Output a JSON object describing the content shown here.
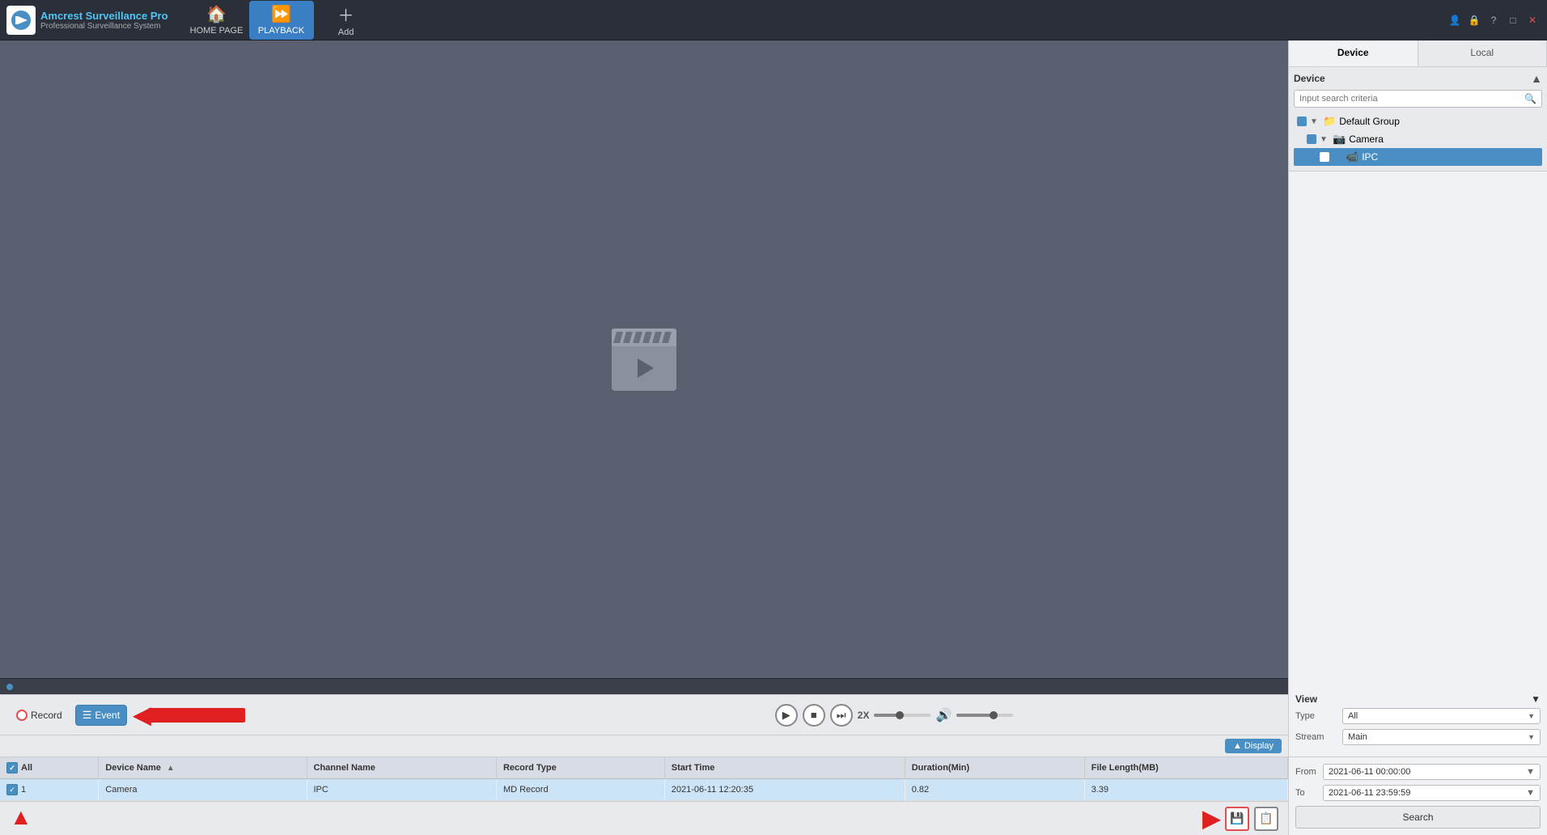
{
  "app": {
    "name": "Amcrest Surveillance Pro",
    "subtitle": "Professional Surveillance System"
  },
  "titlebar": {
    "nav": [
      {
        "id": "home",
        "label": "HOME PAGE",
        "icon": "🏠",
        "active": false
      },
      {
        "id": "playback",
        "label": "PLAYBACK",
        "icon": "▶",
        "active": true
      },
      {
        "id": "add",
        "label": "Add",
        "icon": "+",
        "active": false
      }
    ],
    "controls": [
      "👤",
      "🔒",
      "?",
      "□",
      "×"
    ]
  },
  "controls": {
    "record_label": "Record",
    "event_label": "Event",
    "speed": "2X",
    "display_label": "▲ Display"
  },
  "table": {
    "columns": [
      "All",
      "Device Name",
      "Channel Name",
      "Record Type",
      "Start Time",
      "Duration(Min)",
      "File Length(MB)"
    ],
    "rows": [
      {
        "num": "1",
        "device_name": "Camera",
        "channel_name": "IPC",
        "record_type": "MD Record",
        "start_time": "2021-06-11 12:20:35",
        "duration": "0.82",
        "file_length": "3.39"
      }
    ]
  },
  "right_panel": {
    "tabs": [
      {
        "id": "device",
        "label": "Device",
        "active": true
      },
      {
        "id": "local",
        "label": "Local",
        "active": false
      }
    ],
    "device_section": {
      "title": "Device",
      "search_placeholder": "Input search criteria",
      "tree": {
        "default_group": "Default Group",
        "camera": "Camera",
        "ipc": "IPC"
      }
    },
    "view_section": {
      "title": "View",
      "type_label": "Type",
      "type_value": "All",
      "stream_label": "Stream",
      "stream_value": "Main"
    },
    "date_section": {
      "from_label": "From",
      "from_value": "2021-06-11 00:00:00",
      "to_label": "To",
      "to_value": "2021-06-11 23:59:59",
      "search_btn": "Search"
    }
  }
}
